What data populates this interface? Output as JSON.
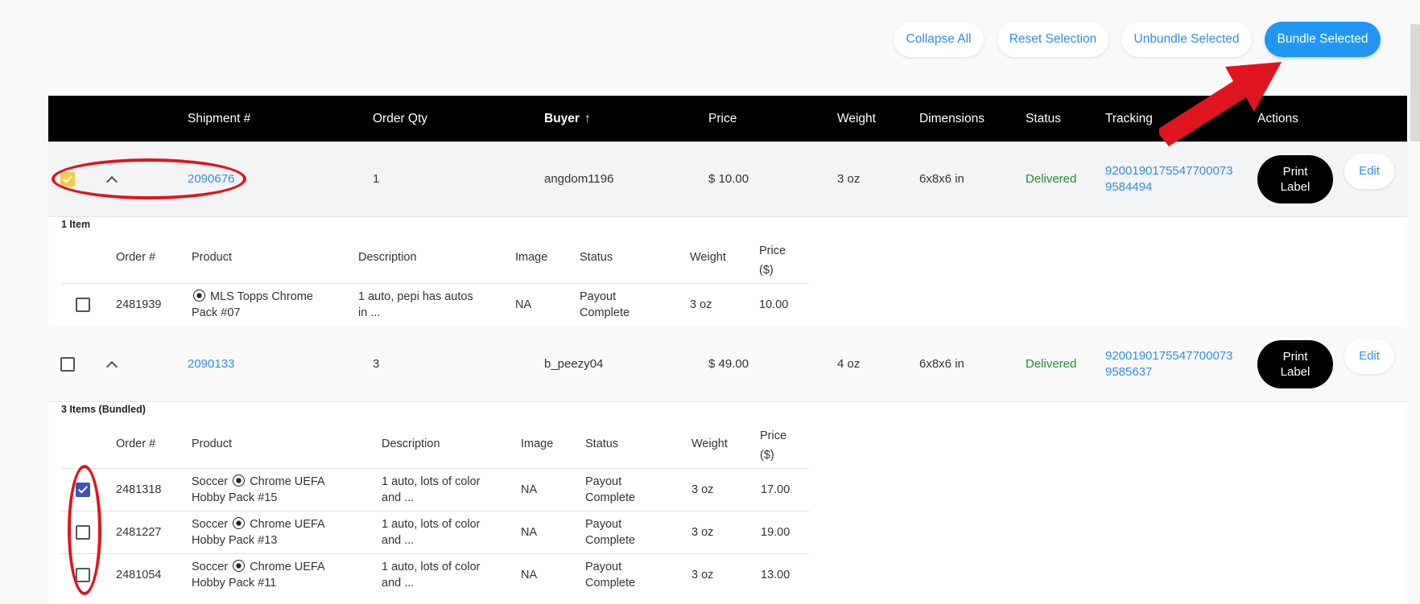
{
  "toolbar": {
    "collapse_all": "Collapse All",
    "reset_selection": "Reset Selection",
    "unbundle_selected": "Unbundle Selected",
    "bundle_selected": "Bundle Selected"
  },
  "table": {
    "headers": {
      "shipment": "Shipment #",
      "order_qty": "Order Qty",
      "buyer": "Buyer",
      "price": "Price",
      "weight": "Weight",
      "dimensions": "Dimensions",
      "status": "Status",
      "tracking": "Tracking",
      "actions": "Actions"
    },
    "sort_indicator": "↑"
  },
  "shipments": [
    {
      "shipment_no": "2090676",
      "order_qty": "1",
      "buyer": "angdom1196",
      "price": "$ 10.00",
      "weight": "3 oz",
      "dimensions": "6x8x6 in",
      "status": "Delivered",
      "tracking_line1": "9200190175547700073",
      "tracking_line2": "9584494",
      "print_line1": "Print",
      "print_line2": "Label",
      "edit": "Edit",
      "items_label": "1 Item",
      "sub_headers": {
        "order": "Order #",
        "product": "Product",
        "description": "Description",
        "image": "Image",
        "status": "Status",
        "weight": "Weight",
        "price_line1": "Price",
        "price_line2": "($)"
      },
      "items": [
        {
          "order": "2481939",
          "product_line1": "MLS Topps Chrome",
          "product_line2": "Pack #07",
          "desc_line1": "1 auto, pepi has autos",
          "desc_line2": "in ...",
          "image": "NA",
          "status_line1": "Payout",
          "status_line2": "Complete",
          "weight": "3 oz",
          "price": "10.00"
        }
      ]
    },
    {
      "shipment_no": "2090133",
      "order_qty": "3",
      "buyer": "b_peezy04",
      "price": "$ 49.00",
      "weight": "4 oz",
      "dimensions": "6x8x6 in",
      "status": "Delivered",
      "tracking_line1": "9200190175547700073",
      "tracking_line2": "9585637",
      "print_line1": "Print",
      "print_line2": "Label",
      "edit": "Edit",
      "items_label": "3 Items (Bundled)",
      "sub_headers": {
        "order": "Order #",
        "product": "Product",
        "description": "Description",
        "image": "Image",
        "status": "Status",
        "weight": "Weight",
        "price_line1": "Price",
        "price_line2": "($)"
      },
      "items": [
        {
          "order": "2481318",
          "product_pre": "Soccer",
          "product_post": "Chrome UEFA",
          "product_line2": "Hobby Pack #15",
          "desc_line1": "1 auto, lots of color",
          "desc_line2": "and ...",
          "image": "NA",
          "status_line1": "Payout",
          "status_line2": "Complete",
          "weight": "3 oz",
          "price": "17.00"
        },
        {
          "order": "2481227",
          "product_pre": "Soccer",
          "product_post": "Chrome UEFA",
          "product_line2": "Hobby Pack #13",
          "desc_line1": "1 auto, lots of color",
          "desc_line2": "and ...",
          "image": "NA",
          "status_line1": "Payout",
          "status_line2": "Complete",
          "weight": "3 oz",
          "price": "19.00"
        },
        {
          "order": "2481054",
          "product_pre": "Soccer",
          "product_post": "Chrome UEFA",
          "product_line2": "Hobby Pack #11",
          "desc_line1": "1 auto, lots of color",
          "desc_line2": "and ...",
          "image": "NA",
          "status_line1": "Payout",
          "status_line2": "Complete",
          "weight": "3 oz",
          "price": "13.00"
        }
      ]
    }
  ],
  "colors": {
    "accent": "#2196f3",
    "link": "#2f8fe0",
    "status_delivered": "#1e8f2e",
    "annotation": "#e0141e",
    "checkbox_selected_shipment": "#f7c948",
    "checkbox_selected_item": "#3f51b5"
  }
}
